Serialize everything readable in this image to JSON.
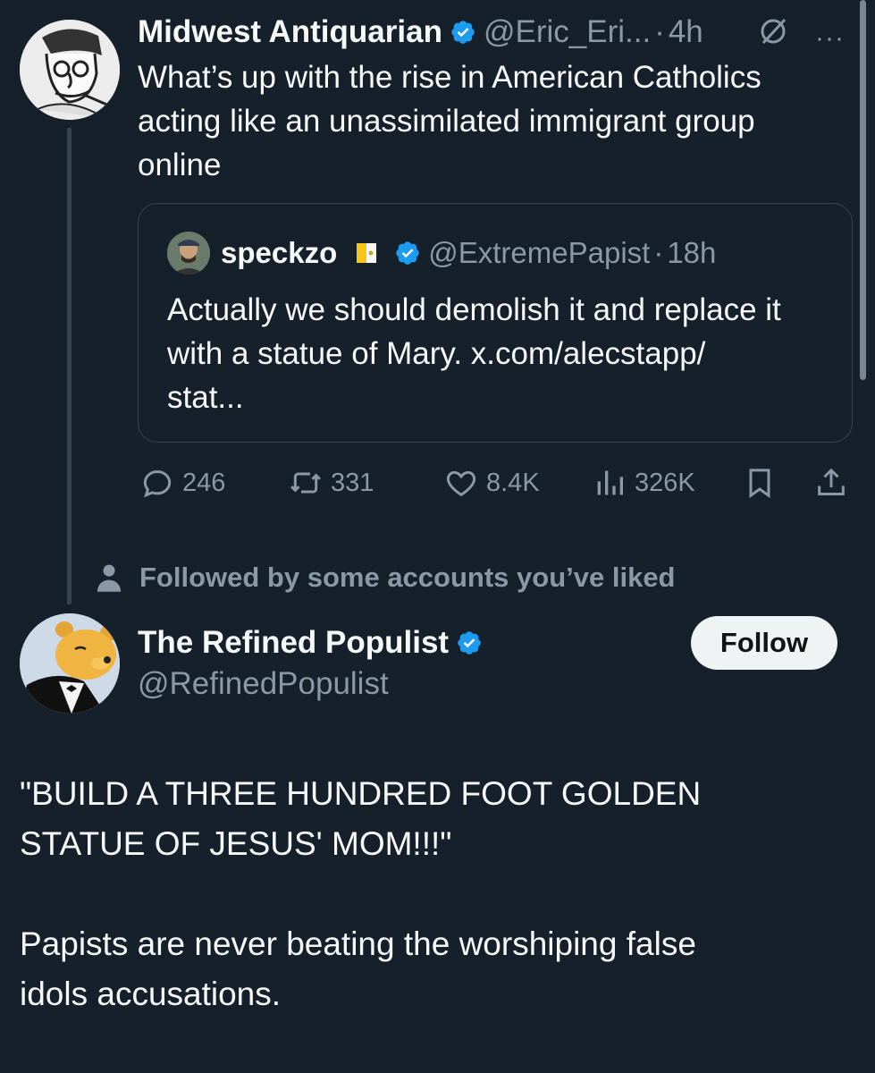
{
  "colors": {
    "background": "#15202b",
    "text": "#f7f9f9",
    "muted": "#8b98a5",
    "verified": "#1d9bf0",
    "border": "#38444d"
  },
  "tweet1": {
    "name": "Midwest Antiquarian",
    "handle": "@Eric_Eri...",
    "separator": "·",
    "time": "4h",
    "more": "···",
    "text": "What’s up with the rise in American Catholics acting like an unassimilated immigrant group online",
    "icons": {
      "verified": "verified-badge-icon",
      "grok": "grok-icon",
      "more": "more-icon"
    }
  },
  "quote": {
    "name": "speckzo",
    "handle": "@ExtremePapist",
    "separator": "·",
    "time": "18h",
    "text": "Actually we should demolish it and replace it with a statue of Mary. x.com/alecstapp/\nstat...",
    "icons": {
      "flag": "vatican-flag-icon",
      "verified": "verified-badge-icon"
    }
  },
  "actions": {
    "replies": "246",
    "reposts": "331",
    "likes": "8.4K",
    "views": "326K",
    "icons": [
      "reply-icon",
      "repost-icon",
      "like-icon",
      "views-icon",
      "bookmark-icon",
      "share-icon"
    ]
  },
  "followed_by": {
    "text": "Followed by some accounts you’ve liked",
    "icon": "person-icon"
  },
  "tweet2": {
    "name": "The Refined Populist",
    "handle": "@RefinedPopulist",
    "follow_label": "Follow",
    "text": "\"BUILD A THREE HUNDRED FOOT GOLDEN\nSTATUE OF JESUS' MOM!!!\"\n\nPapists are never beating the worshiping false\nidols accusations."
  }
}
